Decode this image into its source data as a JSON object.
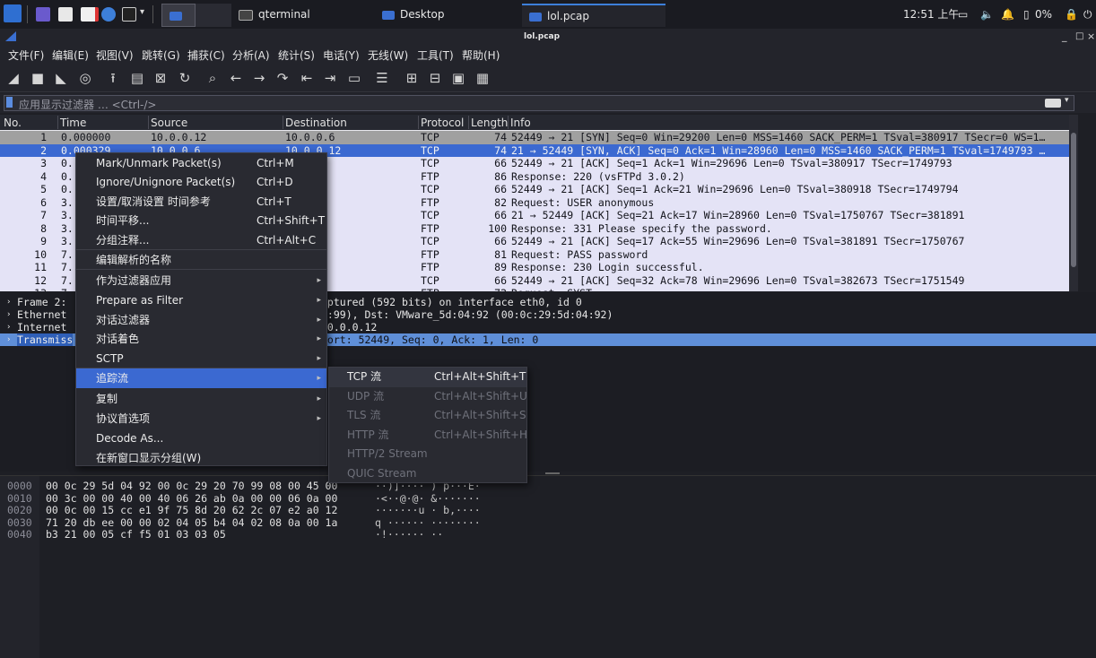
{
  "taskbar": {
    "tasks": [
      {
        "label": ""
      },
      {
        "label": "qterminal"
      },
      {
        "label": "Desktop"
      },
      {
        "label": "lol.pcap"
      }
    ],
    "clock": "12:51 上午",
    "battery": "0%"
  },
  "window": {
    "title": "lol.pcap",
    "controls": [
      "_",
      "□",
      "×"
    ]
  },
  "menubar": [
    "文件(F)",
    "编辑(E)",
    "视图(V)",
    "跳转(G)",
    "捕获(C)",
    "分析(A)",
    "统计(S)",
    "电话(Y)",
    "无线(W)",
    "工具(T)",
    "帮助(H)"
  ],
  "filter": {
    "placeholder": "应用显示过滤器 … <Ctrl-/>"
  },
  "packet_list": {
    "columns": [
      "No.",
      "Time",
      "Source",
      "Destination",
      "Protocol",
      "Length",
      "Info"
    ],
    "rows": [
      {
        "no": "1",
        "time": "0.000000",
        "src": "10.0.0.12",
        "dst": "10.0.0.6",
        "proto": "TCP",
        "len": "74",
        "info": "52449 → 21 [SYN] Seq=0 Win=29200 Len=0 MSS=1460 SACK_PERM=1 TSval=380917 TSecr=0 WS=1…"
      },
      {
        "no": "2",
        "time": "0.000329",
        "src": "10.0.0.6",
        "dst": "10.0.0.12",
        "proto": "TCP",
        "len": "74",
        "info": "21 → 52449 [SYN, ACK] Seq=0 Ack=1 Win=28960 Len=0 MSS=1460 SACK_PERM=1 TSval=1749793 …"
      },
      {
        "no": "3",
        "time": "0.",
        "src": "",
        "dst": "6",
        "proto": "TCP",
        "len": "66",
        "info": "52449 → 21 [ACK] Seq=1 Ack=1 Win=29696 Len=0 TSval=380917 TSecr=1749793"
      },
      {
        "no": "4",
        "time": "0.",
        "src": "",
        "dst": "12",
        "proto": "FTP",
        "len": "86",
        "info": "Response: 220 (vsFTPd 3.0.2)"
      },
      {
        "no": "5",
        "time": "0.",
        "src": "",
        "dst": "6",
        "proto": "TCP",
        "len": "66",
        "info": "52449 → 21 [ACK] Seq=1 Ack=21 Win=29696 Len=0 TSval=380918 TSecr=1749794"
      },
      {
        "no": "6",
        "time": "3.",
        "src": "",
        "dst": "6",
        "proto": "FTP",
        "len": "82",
        "info": "Request: USER anonymous"
      },
      {
        "no": "7",
        "time": "3.",
        "src": "",
        "dst": "12",
        "proto": "TCP",
        "len": "66",
        "info": "21 → 52449 [ACK] Seq=21 Ack=17 Win=28960 Len=0 TSval=1750767 TSecr=381891"
      },
      {
        "no": "8",
        "time": "3.",
        "src": "",
        "dst": "12",
        "proto": "FTP",
        "len": "100",
        "info": "Response: 331 Please specify the password."
      },
      {
        "no": "9",
        "time": "3.",
        "src": "",
        "dst": "6",
        "proto": "TCP",
        "len": "66",
        "info": "52449 → 21 [ACK] Seq=17 Ack=55 Win=29696 Len=0 TSval=381891 TSecr=1750767"
      },
      {
        "no": "10",
        "time": "7.",
        "src": "",
        "dst": "6",
        "proto": "FTP",
        "len": "81",
        "info": "Request: PASS password"
      },
      {
        "no": "11",
        "time": "7.",
        "src": "",
        "dst": "12",
        "proto": "FTP",
        "len": "89",
        "info": "Response: 230 Login successful."
      },
      {
        "no": "12",
        "time": "7.",
        "src": "",
        "dst": "6",
        "proto": "TCP",
        "len": "66",
        "info": "52449 → 21 [ACK] Seq=32 Ack=78 Win=29696 Len=0 TSval=382673 TSecr=1751549"
      },
      {
        "no": "13",
        "time": "7.",
        "src": "",
        "dst": "6",
        "proto": "FTP",
        "len": "72",
        "info": "Request: SYST"
      }
    ]
  },
  "details": [
    {
      "left": "Frame 2:",
      "right": "aptured (592 bits) on interface eth0, id 0"
    },
    {
      "left": "Ethernet",
      "right": "0:99), Dst: VMware_5d:04:92 (00:0c:29:5d:04:92)"
    },
    {
      "left": "Internet",
      "right": " 10.0.0.12"
    },
    {
      "left": "Transmiss",
      "right": " Port: 52449, Seq: 0, Ack: 1, Len: 0"
    }
  ],
  "bytes": [
    {
      "off": "0000",
      "hex": "00 0c 29 5d 04 92 00 0c  29 20 70 99 08 00 45 00",
      "ascii": "··)]····  ) p···E·"
    },
    {
      "off": "0010",
      "hex": "00 3c 00 00 40 00 40 06  26 ab 0a 00 00 06 0a 00",
      "ascii": "·<··@·@·  &·······"
    },
    {
      "off": "0020",
      "hex": "00 0c 00 15 cc e1 9f 75  8d 20 62 2c 07 e2 a0 12",
      "ascii": "·······u  · b,····"
    },
    {
      "off": "0030",
      "hex": "71 20 db ee 00 00 02 04  05 b4 04 02 08 0a 00 1a",
      "ascii": "q ······  ········"
    },
    {
      "off": "0040",
      "hex": "b3 21 00 05 cf f5 01 03  03 05",
      "ascii": "·!······  ··"
    }
  ],
  "context_menu": [
    {
      "label": "Mark/Unmark Packet(s)",
      "shortcut": "Ctrl+M"
    },
    {
      "label": "Ignore/Unignore Packet(s)",
      "shortcut": "Ctrl+D"
    },
    {
      "label": "设置/取消设置 时间参考",
      "shortcut": "Ctrl+T"
    },
    {
      "label": "时间平移...",
      "shortcut": "Ctrl+Shift+T"
    },
    {
      "label": "分组注释...",
      "shortcut": "Ctrl+Alt+C"
    },
    {
      "label": "编辑解析的名称",
      "shortcut": ""
    },
    {
      "label": "作为过滤器应用",
      "shortcut": ""
    },
    {
      "label": "Prepare as Filter",
      "shortcut": ""
    },
    {
      "label": "对话过滤器",
      "shortcut": ""
    },
    {
      "label": "对话着色",
      "shortcut": ""
    },
    {
      "label": "SCTP",
      "shortcut": ""
    },
    {
      "label": "追踪流",
      "shortcut": ""
    },
    {
      "label": "复制",
      "shortcut": ""
    },
    {
      "label": "协议首选项",
      "shortcut": ""
    },
    {
      "label": "Decode As...",
      "shortcut": ""
    },
    {
      "label": "在新窗口显示分组(W)",
      "shortcut": ""
    }
  ],
  "submenu": [
    {
      "label": "TCP 流",
      "shortcut": "Ctrl+Alt+Shift+T"
    },
    {
      "label": "UDP 流",
      "shortcut": "Ctrl+Alt+Shift+U"
    },
    {
      "label": "TLS 流",
      "shortcut": "Ctrl+Alt+Shift+S"
    },
    {
      "label": "HTTP 流",
      "shortcut": "Ctrl+Alt+Shift+H"
    },
    {
      "label": "HTTP/2 Stream",
      "shortcut": ""
    },
    {
      "label": "QUIC Stream",
      "shortcut": ""
    }
  ],
  "colors": {
    "selected_row": "#3b69d1",
    "tcp_row": "#e4e3f6",
    "ftp_row": "#e4e3f6",
    "syn_row": "#a0a0a0"
  }
}
